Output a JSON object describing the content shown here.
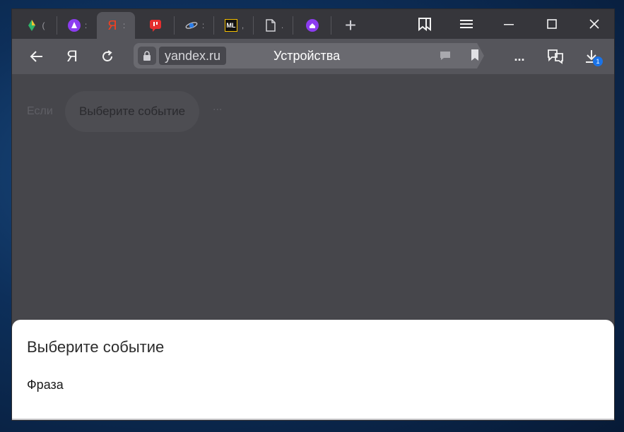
{
  "browser": {
    "tabs": [
      {
        "icon": "pin-logo-icon",
        "color": "#f1c232"
      },
      {
        "icon": "alice-icon",
        "color": "#8c3cf0"
      },
      {
        "icon": "yandex-ya-icon",
        "color": "#fc3f1d",
        "text": "Я",
        "active": true
      },
      {
        "icon": "red-chat-icon",
        "color": "#e52e2e"
      },
      {
        "icon": "planet-icon",
        "color": "#2b7de9"
      },
      {
        "icon": "ml-logo-icon",
        "color": "#f6c000",
        "text": "ML"
      },
      {
        "icon": "document-icon",
        "color": "#d0d0d5"
      },
      {
        "icon": "alice-home-icon",
        "color": "#8c3cf0"
      }
    ],
    "new_tab_label": "+",
    "address": {
      "domain": "yandex.ru",
      "title": "Устройства"
    },
    "toolbar": {
      "yandex_label": "Я",
      "more_label": "...",
      "downloads_badge": "1"
    }
  },
  "page": {
    "if_label": "Если",
    "event_chip": "Выберите событие",
    "ellipsis": "..."
  },
  "sheet": {
    "title": "Выберите событие",
    "options": [
      "Фраза"
    ]
  },
  "colors": {
    "accent": "#1a73e8",
    "tabstrip": "#36363b",
    "toolbar": "#55555b",
    "content_bg": "#46464b"
  }
}
